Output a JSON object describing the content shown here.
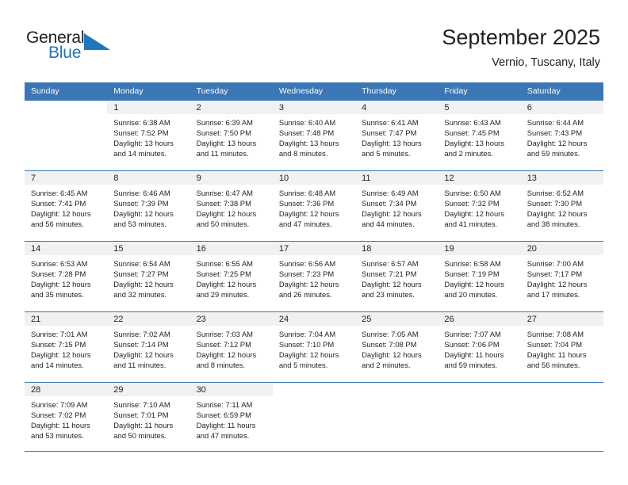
{
  "brand": {
    "name_part1": "General",
    "name_part2": "Blue",
    "triangle_color": "#1f76bc",
    "accent_color": "#3b76b5"
  },
  "header": {
    "title": "September 2025",
    "subtitle": "Vernio, Tuscany, Italy"
  },
  "weekday_headers": [
    "Sunday",
    "Monday",
    "Tuesday",
    "Wednesday",
    "Thursday",
    "Friday",
    "Saturday"
  ],
  "weeks": [
    {
      "days": [
        {
          "num": "",
          "lines": [
            "",
            "",
            "",
            ""
          ]
        },
        {
          "num": "1",
          "lines": [
            "Sunrise: 6:38 AM",
            "Sunset: 7:52 PM",
            "Daylight: 13 hours",
            "and 14 minutes."
          ]
        },
        {
          "num": "2",
          "lines": [
            "Sunrise: 6:39 AM",
            "Sunset: 7:50 PM",
            "Daylight: 13 hours",
            "and 11 minutes."
          ]
        },
        {
          "num": "3",
          "lines": [
            "Sunrise: 6:40 AM",
            "Sunset: 7:48 PM",
            "Daylight: 13 hours",
            "and 8 minutes."
          ]
        },
        {
          "num": "4",
          "lines": [
            "Sunrise: 6:41 AM",
            "Sunset: 7:47 PM",
            "Daylight: 13 hours",
            "and 5 minutes."
          ]
        },
        {
          "num": "5",
          "lines": [
            "Sunrise: 6:43 AM",
            "Sunset: 7:45 PM",
            "Daylight: 13 hours",
            "and 2 minutes."
          ]
        },
        {
          "num": "6",
          "lines": [
            "Sunrise: 6:44 AM",
            "Sunset: 7:43 PM",
            "Daylight: 12 hours",
            "and 59 minutes."
          ]
        }
      ]
    },
    {
      "days": [
        {
          "num": "7",
          "lines": [
            "Sunrise: 6:45 AM",
            "Sunset: 7:41 PM",
            "Daylight: 12 hours",
            "and 56 minutes."
          ]
        },
        {
          "num": "8",
          "lines": [
            "Sunrise: 6:46 AM",
            "Sunset: 7:39 PM",
            "Daylight: 12 hours",
            "and 53 minutes."
          ]
        },
        {
          "num": "9",
          "lines": [
            "Sunrise: 6:47 AM",
            "Sunset: 7:38 PM",
            "Daylight: 12 hours",
            "and 50 minutes."
          ]
        },
        {
          "num": "10",
          "lines": [
            "Sunrise: 6:48 AM",
            "Sunset: 7:36 PM",
            "Daylight: 12 hours",
            "and 47 minutes."
          ]
        },
        {
          "num": "11",
          "lines": [
            "Sunrise: 6:49 AM",
            "Sunset: 7:34 PM",
            "Daylight: 12 hours",
            "and 44 minutes."
          ]
        },
        {
          "num": "12",
          "lines": [
            "Sunrise: 6:50 AM",
            "Sunset: 7:32 PM",
            "Daylight: 12 hours",
            "and 41 minutes."
          ]
        },
        {
          "num": "13",
          "lines": [
            "Sunrise: 6:52 AM",
            "Sunset: 7:30 PM",
            "Daylight: 12 hours",
            "and 38 minutes."
          ]
        }
      ]
    },
    {
      "days": [
        {
          "num": "14",
          "lines": [
            "Sunrise: 6:53 AM",
            "Sunset: 7:28 PM",
            "Daylight: 12 hours",
            "and 35 minutes."
          ]
        },
        {
          "num": "15",
          "lines": [
            "Sunrise: 6:54 AM",
            "Sunset: 7:27 PM",
            "Daylight: 12 hours",
            "and 32 minutes."
          ]
        },
        {
          "num": "16",
          "lines": [
            "Sunrise: 6:55 AM",
            "Sunset: 7:25 PM",
            "Daylight: 12 hours",
            "and 29 minutes."
          ]
        },
        {
          "num": "17",
          "lines": [
            "Sunrise: 6:56 AM",
            "Sunset: 7:23 PM",
            "Daylight: 12 hours",
            "and 26 minutes."
          ]
        },
        {
          "num": "18",
          "lines": [
            "Sunrise: 6:57 AM",
            "Sunset: 7:21 PM",
            "Daylight: 12 hours",
            "and 23 minutes."
          ]
        },
        {
          "num": "19",
          "lines": [
            "Sunrise: 6:58 AM",
            "Sunset: 7:19 PM",
            "Daylight: 12 hours",
            "and 20 minutes."
          ]
        },
        {
          "num": "20",
          "lines": [
            "Sunrise: 7:00 AM",
            "Sunset: 7:17 PM",
            "Daylight: 12 hours",
            "and 17 minutes."
          ]
        }
      ]
    },
    {
      "days": [
        {
          "num": "21",
          "lines": [
            "Sunrise: 7:01 AM",
            "Sunset: 7:15 PM",
            "Daylight: 12 hours",
            "and 14 minutes."
          ]
        },
        {
          "num": "22",
          "lines": [
            "Sunrise: 7:02 AM",
            "Sunset: 7:14 PM",
            "Daylight: 12 hours",
            "and 11 minutes."
          ]
        },
        {
          "num": "23",
          "lines": [
            "Sunrise: 7:03 AM",
            "Sunset: 7:12 PM",
            "Daylight: 12 hours",
            "and 8 minutes."
          ]
        },
        {
          "num": "24",
          "lines": [
            "Sunrise: 7:04 AM",
            "Sunset: 7:10 PM",
            "Daylight: 12 hours",
            "and 5 minutes."
          ]
        },
        {
          "num": "25",
          "lines": [
            "Sunrise: 7:05 AM",
            "Sunset: 7:08 PM",
            "Daylight: 12 hours",
            "and 2 minutes."
          ]
        },
        {
          "num": "26",
          "lines": [
            "Sunrise: 7:07 AM",
            "Sunset: 7:06 PM",
            "Daylight: 11 hours",
            "and 59 minutes."
          ]
        },
        {
          "num": "27",
          "lines": [
            "Sunrise: 7:08 AM",
            "Sunset: 7:04 PM",
            "Daylight: 11 hours",
            "and 56 minutes."
          ]
        }
      ]
    },
    {
      "days": [
        {
          "num": "28",
          "lines": [
            "Sunrise: 7:09 AM",
            "Sunset: 7:02 PM",
            "Daylight: 11 hours",
            "and 53 minutes."
          ]
        },
        {
          "num": "29",
          "lines": [
            "Sunrise: 7:10 AM",
            "Sunset: 7:01 PM",
            "Daylight: 11 hours",
            "and 50 minutes."
          ]
        },
        {
          "num": "30",
          "lines": [
            "Sunrise: 7:11 AM",
            "Sunset: 6:59 PM",
            "Daylight: 11 hours",
            "and 47 minutes."
          ]
        },
        {
          "num": "",
          "lines": [
            "",
            "",
            "",
            ""
          ]
        },
        {
          "num": "",
          "lines": [
            "",
            "",
            "",
            ""
          ]
        },
        {
          "num": "",
          "lines": [
            "",
            "",
            "",
            ""
          ]
        },
        {
          "num": "",
          "lines": [
            "",
            "",
            "",
            ""
          ]
        }
      ]
    }
  ]
}
